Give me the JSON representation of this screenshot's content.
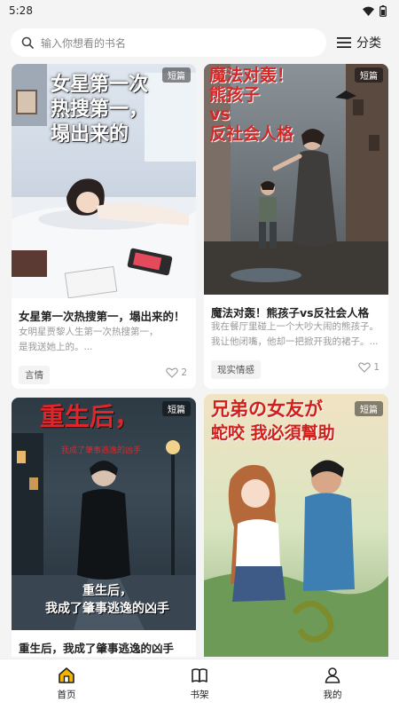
{
  "status": {
    "time": "5:28"
  },
  "search": {
    "placeholder": "输入你想看的书名"
  },
  "header": {
    "category_label": "分类"
  },
  "colors": {
    "accent": "#f5b400",
    "background": "#f4f4f4"
  },
  "cards": [
    {
      "badge": "短篇",
      "cover_title": "女星第一次\n热搜第一，\n塌出来的",
      "title": "女星第一次热搜第一，塌出来的！",
      "desc_line1": "女明星贾黎人生第一次热搜第一，",
      "desc_line2": "是我送她上的。...",
      "tag": "言情",
      "likes": "2"
    },
    {
      "badge": "短篇",
      "cover_title": "魔法对轰！\n熊孩子\nvs\n反社会人格",
      "title": "魔法对轰！熊孩子vs反社会人格",
      "desc_line1": "我在餐厅里碰上一个大吵大闹的熊孩子。",
      "desc_line2": "我让他闭嘴，他却一把掀开我的裙子。...",
      "tag": "现实情感",
      "likes": "1"
    },
    {
      "badge": "短篇",
      "cover_title": "重生后，",
      "cover_subtitle": "我成了肇事逃逸的凶手",
      "cover_bottom": "重生后，\n我成了肇事逃逸的凶手",
      "title": "重生后，我成了肇事逃逸的凶手",
      "desc_line1": "",
      "desc_line2": ""
    },
    {
      "badge": "短篇",
      "cover_title": "兄弟の女友が",
      "cover_title2": "蛇咬 我必須幫助",
      "title": ""
    }
  ],
  "nav": {
    "home": "首页",
    "shelf": "书架",
    "mine": "我的"
  }
}
